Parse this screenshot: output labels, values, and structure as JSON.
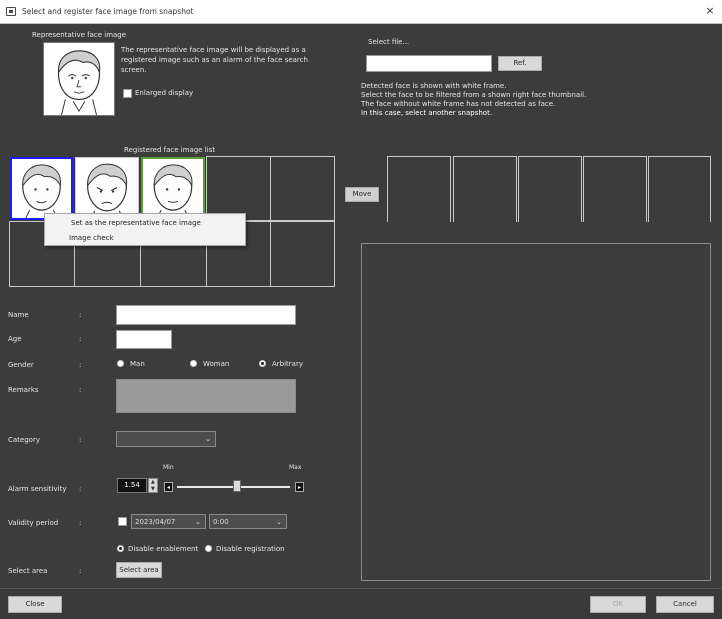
{
  "window": {
    "title": "Select and register face image from snapshot",
    "close_glyph": "×"
  },
  "left": {
    "rep_face_label": "Representative face image",
    "info_text": "The representative face image will be displayed as a registered image such as an alarm of the face search screen.",
    "enlarged_display_label": "Enlarged display",
    "registered_list_label": "Registered face image list",
    "context_menu": [
      "Set as the representative face image",
      "Image check"
    ]
  },
  "form": {
    "colon": ":",
    "name_label": "Name",
    "name_value": "",
    "age_label": "Age",
    "age_value": "",
    "gender_label": "Gender",
    "gender_options": [
      "Man",
      "Woman",
      "Arbitrary"
    ],
    "gender_selected": "Arbitrary",
    "remarks_label": "Remarks",
    "category_label": "Category",
    "category_value": "",
    "sensitivity_label": "Alarm sensitivity",
    "sensitivity_value": "1.54",
    "sensitivity_min": "Min",
    "sensitivity_max": "Max",
    "validity_label": "Validity period",
    "validity_date": "2023/04/07",
    "validity_time": "0:00",
    "validity_modes": [
      "Disable enablement",
      "Disable registration"
    ],
    "validity_mode_selected": "Disable enablement",
    "select_area_label": "Select area",
    "select_area_button": "Select area"
  },
  "right": {
    "select_file_label": "Select file...",
    "file_path_value": "",
    "ref_button": "Ref.",
    "help_lines": [
      "Detected face is shown with white frame.",
      "Select the face to be filtered from a shown right face thumbnail.",
      "The face without white frame has not detected as face.",
      "In this case, select another snapshot."
    ],
    "move_button": "Move"
  },
  "footer": {
    "close_button": "Close",
    "ok_button": "OK",
    "cancel_button": "Cancel"
  },
  "colors": {
    "background": "#3c3c3c",
    "titlebar": "#ffffff",
    "face_selected_border": "#5a9e3a",
    "face_first_border": "#1c1cff"
  }
}
